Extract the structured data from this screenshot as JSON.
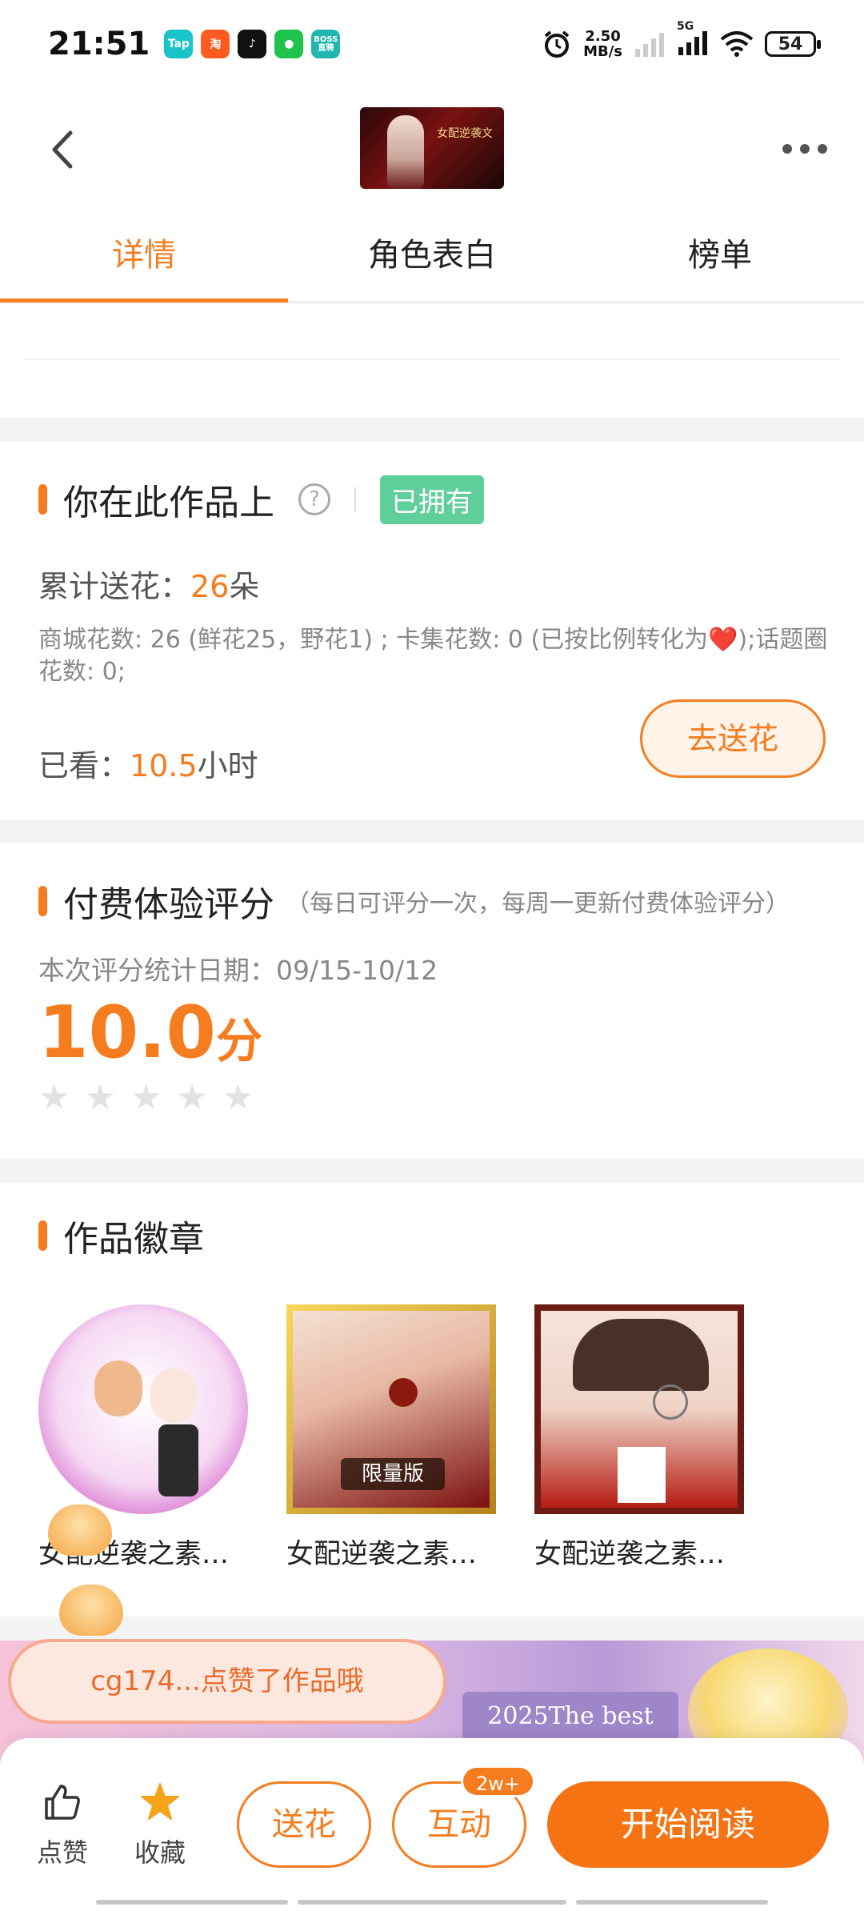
{
  "status_bar": {
    "time": "21:51",
    "apps": [
      "Tap",
      "淘",
      "TikTok",
      "WeChat",
      "BOSS直聘"
    ],
    "network_speed": "2.50",
    "network_unit": "MB/s",
    "signal": "5G",
    "battery": "54"
  },
  "header": {
    "cover_title": "女配逆袭文"
  },
  "tabs": [
    "详情",
    "角色表白",
    "榜单"
  ],
  "ownership": {
    "title": "你在此作品上",
    "owned_badge": "已拥有",
    "flowers_label": "累计送花：",
    "flowers_value": "26",
    "flowers_unit": "朵",
    "flowers_detail": "商城花数: 26 (鲜花25，野花1) ; 卡集花数: 0 (已按比例转化为❤️);话题圈花数: 0;",
    "watched_label": "已看：",
    "watched_value": "10.5",
    "watched_unit": "小时",
    "send_button": "去送花"
  },
  "rating": {
    "title": "付费体验评分",
    "note": "（每日可评分一次，每周一更新付费体验评分）",
    "date_label": "本次评分统计日期：09/15-10/12",
    "score": "10.0",
    "score_unit": "分",
    "stars_total": 5,
    "stars_filled": 0
  },
  "badges": {
    "title": "作品徽章",
    "items": [
      {
        "name": "女配逆袭之素…"
      },
      {
        "name": "女配逆袭之素…",
        "tag": "限量版"
      },
      {
        "name": "女配逆袭之素…"
      }
    ]
  },
  "banner": {
    "text": "2025The best",
    "toast": "cg174...点赞了作品哦"
  },
  "bottom_bar": {
    "like_label": "点赞",
    "favorite_label": "收藏",
    "flower_button": "送花",
    "interact_button": "互动",
    "interact_count": "2w+",
    "read_button": "开始阅读"
  },
  "colors": {
    "accent": "#f57d1f",
    "owned_badge": "#5fcf9b"
  }
}
